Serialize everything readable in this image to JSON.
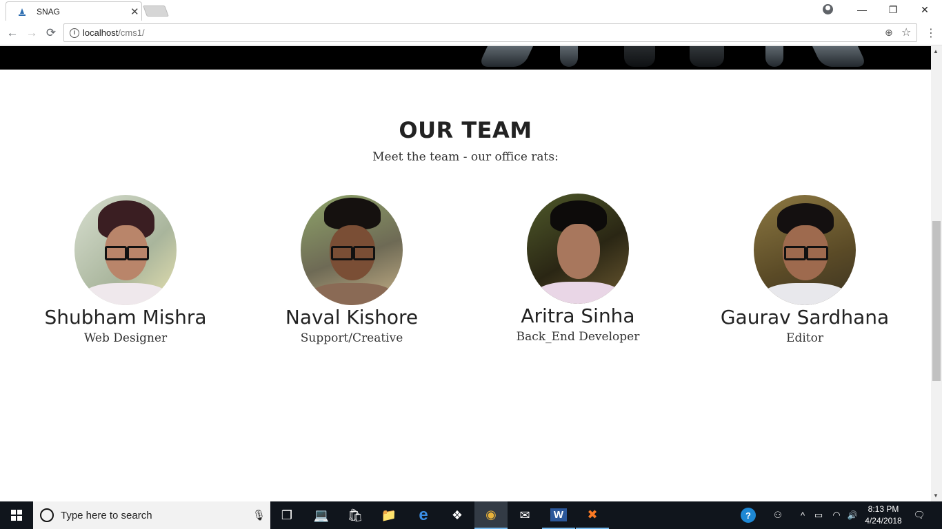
{
  "browser": {
    "tab_title": "SNAG",
    "tab_close": "✕",
    "url_host": "localhost",
    "url_path": "/cms1/",
    "controls": {
      "minimize": "—",
      "restore": "❐",
      "close": "✕"
    },
    "nav": {
      "back": "←",
      "forward": "→",
      "reload": "⟳"
    },
    "info": "i",
    "zoom": "⊕",
    "star": "☆",
    "menu": "⋮"
  },
  "page": {
    "title": "OUR TEAM",
    "subtitle": "Meet the team - our office rats:",
    "members": [
      {
        "name": "Shubham Mishra",
        "role": "Web Designer"
      },
      {
        "name": "Naval Kishore",
        "role": "Support/Creative"
      },
      {
        "name": "Aritra Sinha",
        "role": "Back_End Developer"
      },
      {
        "name": "Gaurav Sardhana",
        "role": "Editor"
      }
    ]
  },
  "taskbar": {
    "search_placeholder": "Type here to search",
    "mic": "🎙",
    "apps": [
      {
        "name": "task-view",
        "glyph": "❐"
      },
      {
        "name": "laptop",
        "glyph": "💻"
      },
      {
        "name": "store",
        "glyph": "🛍"
      },
      {
        "name": "file-explorer",
        "glyph": "📁"
      },
      {
        "name": "edge",
        "glyph": "e"
      },
      {
        "name": "dropbox",
        "glyph": "❖"
      },
      {
        "name": "chrome",
        "glyph": "◉"
      },
      {
        "name": "mail",
        "glyph": "✉"
      },
      {
        "name": "word",
        "glyph": "W"
      },
      {
        "name": "xampp",
        "glyph": "✖"
      }
    ],
    "tray": {
      "help": "?",
      "people": "⚇",
      "chevron": "^",
      "battery": "▭",
      "wifi": "◠",
      "volume": "🔊",
      "notifications": "🗨"
    },
    "time": "8:13 PM",
    "date": "4/24/2018"
  }
}
